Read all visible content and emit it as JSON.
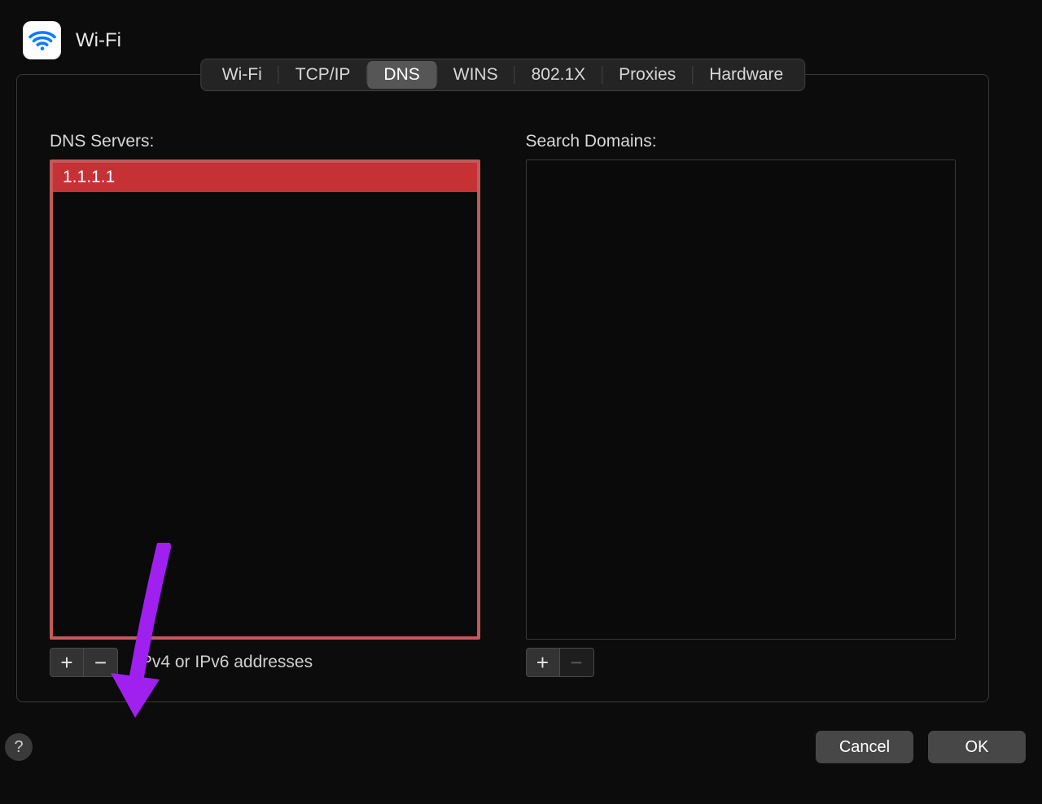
{
  "header": {
    "title": "Wi-Fi"
  },
  "tabs": {
    "items": [
      {
        "label": "Wi-Fi",
        "active": false
      },
      {
        "label": "TCP/IP",
        "active": false
      },
      {
        "label": "DNS",
        "active": true
      },
      {
        "label": "WINS",
        "active": false
      },
      {
        "label": "802.1X",
        "active": false
      },
      {
        "label": "Proxies",
        "active": false
      },
      {
        "label": "Hardware",
        "active": false
      }
    ]
  },
  "dns": {
    "label": "DNS Servers:",
    "servers": [
      {
        "value": "1.1.1.1",
        "selected": true
      }
    ],
    "hint": "IPv4 or IPv6 addresses",
    "add_glyph": "+",
    "remove_glyph": "−"
  },
  "search_domains": {
    "label": "Search Domains:",
    "items": [],
    "add_glyph": "+",
    "remove_glyph": "−"
  },
  "footer": {
    "help_glyph": "?",
    "cancel_label": "Cancel",
    "ok_label": "OK"
  },
  "annotation": {
    "arrow_color": "#a020f0"
  }
}
